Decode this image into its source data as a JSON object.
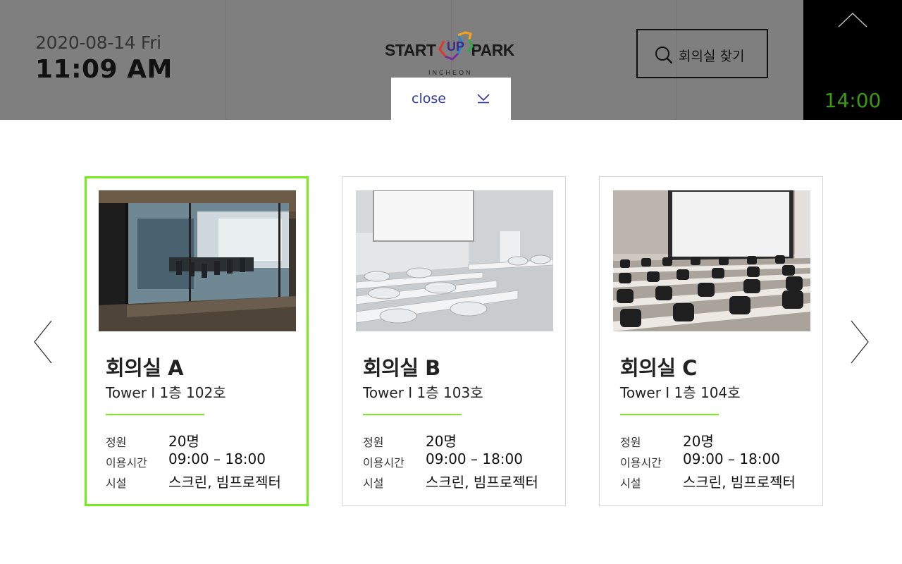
{
  "header": {
    "date": "2020-08-14 Fri",
    "time": "11:09 AM",
    "logo": {
      "main_left": "START",
      "main_right": "PARK",
      "mark": "UP",
      "sub": "INCHEON"
    },
    "close_label": "close",
    "search_label": "회의실 찾기",
    "side_time": "14:00"
  },
  "colors": {
    "header_bg": "#7f7f7f",
    "accent_green": "#73ed1c",
    "clock_green": "#3a9a12",
    "close_blue": "#2e3aa0"
  },
  "rooms": [
    {
      "name": "회의실 A",
      "location": "Tower Ⅰ  1층 102호",
      "selected": true,
      "info": [
        {
          "label": "정원",
          "value": "20명"
        },
        {
          "label": "이용시간",
          "value": "09:00 – 18:00"
        },
        {
          "label": "시설",
          "value": "스크린, 빔프로젝터"
        }
      ]
    },
    {
      "name": "회의실 B",
      "location": "Tower Ⅰ  1층 103호",
      "selected": false,
      "info": [
        {
          "label": "정원",
          "value": "20명"
        },
        {
          "label": "이용시간",
          "value": "09:00 – 18:00"
        },
        {
          "label": "시설",
          "value": "스크린, 빔프로젝터"
        }
      ]
    },
    {
      "name": "회의실 C",
      "location": "Tower Ⅰ  1층 104호",
      "selected": false,
      "info": [
        {
          "label": "정원",
          "value": "20명"
        },
        {
          "label": "이용시간",
          "value": "09:00 – 18:00"
        },
        {
          "label": "시설",
          "value": "스크린, 빔프로젝터"
        }
      ]
    }
  ]
}
